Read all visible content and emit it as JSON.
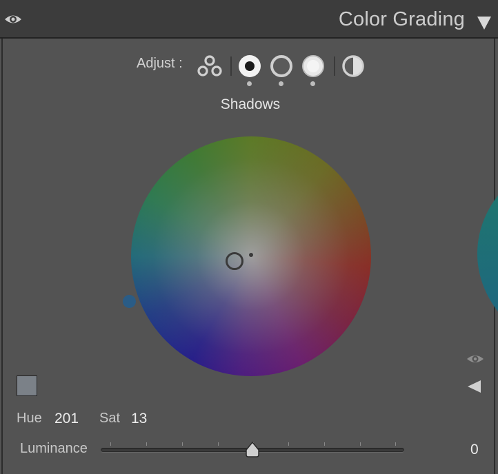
{
  "header": {
    "title": "Color Grading",
    "visibility_icon": "eye-icon",
    "collapse_icon": "triangle-down-icon"
  },
  "adjust": {
    "label": "Adjust :",
    "modes": [
      {
        "icon": "three-circles-icon",
        "selected": false
      },
      {
        "icon": "shadows-circle-icon",
        "selected": true
      },
      {
        "icon": "midtones-circle-icon",
        "selected": false
      },
      {
        "icon": "highlights-circle-icon",
        "selected": false
      },
      {
        "icon": "global-half-circle-icon",
        "selected": false
      }
    ]
  },
  "wheel": {
    "label": "Shadows",
    "hue": 201,
    "saturation": 13
  },
  "fields": {
    "hue_label": "Hue",
    "hue_value": "201",
    "sat_label": "Sat",
    "sat_value": "13",
    "swatch_color": "#7b8188"
  },
  "luminance": {
    "label": "Luminance",
    "value": "0",
    "min": -100,
    "max": 100,
    "current": 0
  },
  "colors": {
    "panel_bg": "#535353",
    "header_bg": "#3c3c3c",
    "hue_marker": "#2a5c86"
  }
}
